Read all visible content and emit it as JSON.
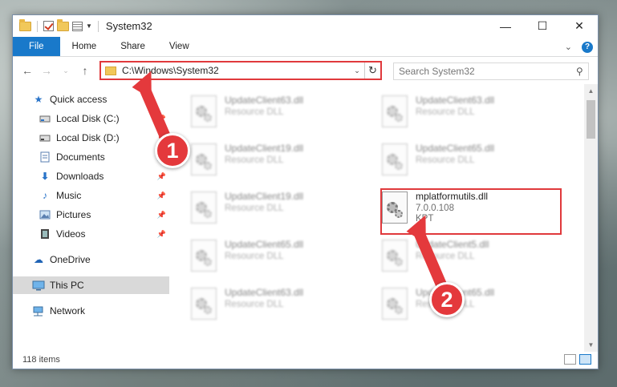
{
  "window": {
    "title": "System32",
    "controls": {
      "minimize": "—",
      "maximize": "☐",
      "close": "✕"
    }
  },
  "ribbon": {
    "tabs": [
      "File",
      "Home",
      "Share",
      "View"
    ],
    "expand_icon": "chevron-down-icon",
    "help_label": "?"
  },
  "address": {
    "path": "C:\\Windows\\System32",
    "dropdown": "⌄",
    "refresh": "↻"
  },
  "search": {
    "placeholder": "Search System32"
  },
  "nav": {
    "items": [
      {
        "label": "Quick access",
        "icon": "star-icon",
        "pinned": false
      },
      {
        "label": "Local Disk (C:)",
        "icon": "drive-icon",
        "pinned": true
      },
      {
        "label": "Local Disk (D:)",
        "icon": "drive-icon",
        "pinned": true
      },
      {
        "label": "Documents",
        "icon": "documents-icon",
        "pinned": true
      },
      {
        "label": "Downloads",
        "icon": "download-icon",
        "pinned": true
      },
      {
        "label": "Music",
        "icon": "music-icon",
        "pinned": true
      },
      {
        "label": "Pictures",
        "icon": "pictures-icon",
        "pinned": true
      },
      {
        "label": "Videos",
        "icon": "videos-icon",
        "pinned": true
      },
      {
        "label": "OneDrive",
        "icon": "cloud-icon",
        "pinned": false
      },
      {
        "label": "This PC",
        "icon": "computer-icon",
        "pinned": false,
        "selected": true
      },
      {
        "label": "Network",
        "icon": "network-icon",
        "pinned": false
      }
    ]
  },
  "files": [
    {
      "name": "UpdateClient63.dll",
      "sub": "Resource DLL",
      "blurred": true
    },
    {
      "name": "UpdateClient63.dll",
      "sub": "Resource DLL",
      "blurred": true
    },
    {
      "name": "UpdateClient19.dll",
      "sub": "Resource DLL",
      "blurred": true
    },
    {
      "name": "UpdateClient65.dll",
      "sub": "Resource DLL",
      "blurred": true
    },
    {
      "name": "UpdateClient19.dll",
      "sub": "Resource DLL",
      "blurred": true
    },
    {
      "name": "mplatformutils.dll",
      "sub": "7.0.0.108",
      "sub2": "KPT",
      "blurred": false
    },
    {
      "name": "UpdateClient65.dll",
      "sub": "Resource DLL",
      "blurred": true
    },
    {
      "name": "UpdateClient5.dll",
      "sub": "Resource DLL",
      "blurred": true
    },
    {
      "name": "UpdateClient63.dll",
      "sub": "Resource DLL",
      "blurred": true
    },
    {
      "name": "UpdateClient65.dll",
      "sub": "Resource DLL",
      "blurred": true
    }
  ],
  "status": {
    "item_count": "118 items"
  },
  "annotations": {
    "step1": "1",
    "step2": "2",
    "color": "#e4393c"
  }
}
